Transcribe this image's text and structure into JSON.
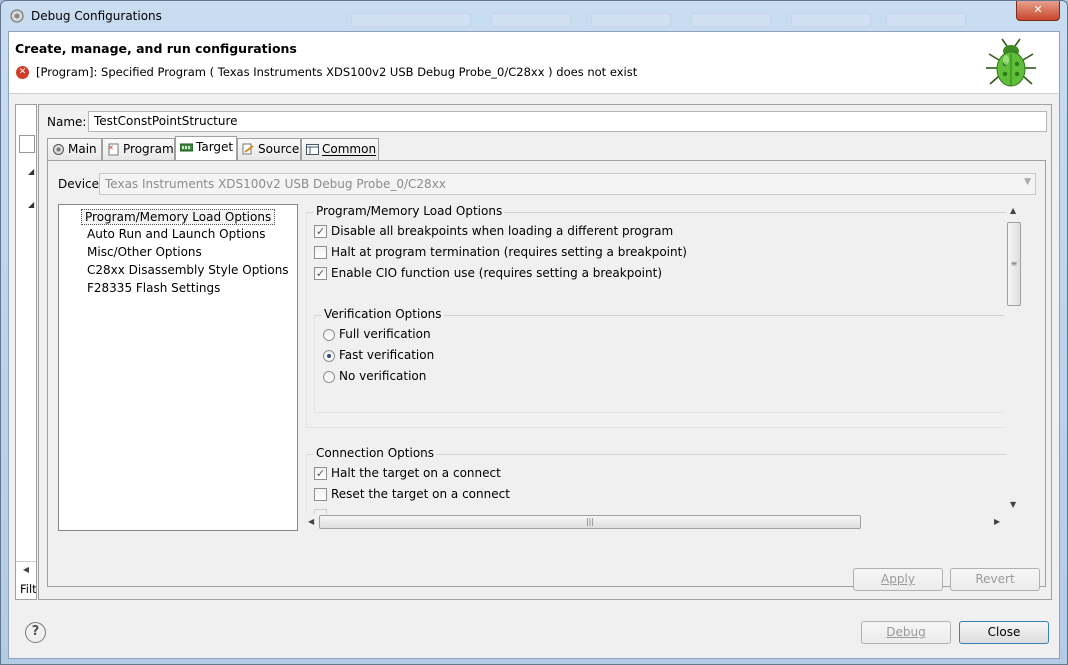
{
  "window": {
    "title": "Debug Configurations",
    "controls": {
      "minimize": "—",
      "maximize": "□",
      "close": "✕"
    }
  },
  "header": {
    "title": "Create, manage, and run configurations",
    "error_message": "[Program]: Specified Program ( Texas Instruments XDS100v2 USB Debug Probe_0/C28xx )  does not exist"
  },
  "left_pane": {
    "filter_label": "Filt"
  },
  "config": {
    "name_label": "Name:",
    "name_value": "TestConstPointStructure"
  },
  "tabs": [
    {
      "label": "Main",
      "icon": "main-icon"
    },
    {
      "label": "Program",
      "icon": "program-icon"
    },
    {
      "label": "Target",
      "icon": "target-icon",
      "active": true
    },
    {
      "label": "Source",
      "icon": "source-icon"
    },
    {
      "label": "Common",
      "icon": "common-icon"
    }
  ],
  "target": {
    "device_label": "Device",
    "device_value": "Texas Instruments XDS100v2 USB Debug Probe_0/C28xx",
    "option_categories": [
      "Program/Memory Load Options",
      "Auto Run and Launch Options",
      "Misc/Other Options",
      "C28xx Disassembly Style Options",
      "F28335 Flash Settings"
    ],
    "load_group": {
      "title": "Program/Memory Load Options",
      "options": [
        {
          "label": "Disable all breakpoints when loading a different program",
          "checked": true
        },
        {
          "label": "Halt at program termination (requires setting a breakpoint)",
          "checked": false
        },
        {
          "label": "Enable CIO function use (requires setting a breakpoint)",
          "checked": true
        }
      ]
    },
    "verification_group": {
      "title": "Verification Options",
      "options": [
        {
          "label": "Full verification",
          "selected": false
        },
        {
          "label": "Fast verification",
          "selected": true
        },
        {
          "label": "No verification",
          "selected": false
        }
      ]
    },
    "connection_group": {
      "title": "Connection Options",
      "options": [
        {
          "label": "Halt the target on a connect",
          "checked": true
        },
        {
          "label": "Reset the target on a connect",
          "checked": false
        }
      ]
    }
  },
  "buttons": {
    "apply": "Apply",
    "revert": "Revert",
    "debug": "Debug",
    "close": "Close",
    "help": "?"
  },
  "colors": {
    "error": "#d13b2a",
    "bug_green": "#5fbf3a"
  }
}
